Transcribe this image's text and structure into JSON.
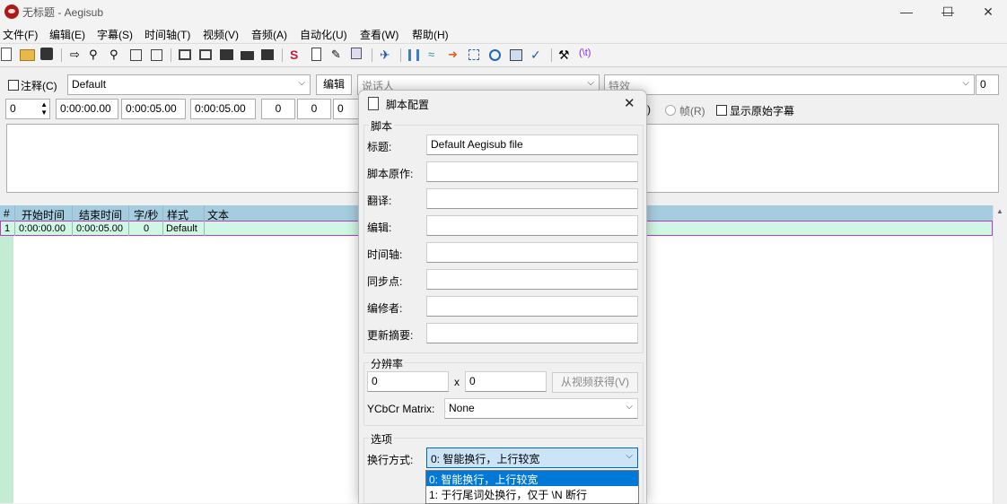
{
  "window": {
    "title": "无标题 - Aegisub",
    "minimize": "—",
    "maximize": "☐",
    "close": "✕"
  },
  "menu": [
    "文件(F)",
    "编辑(E)",
    "字幕(S)",
    "时间轴(T)",
    "视频(V)",
    "音频(A)",
    "自动化(U)",
    "查看(W)",
    "帮助(H)"
  ],
  "toolbar": {
    "icons": [
      "new-file-icon",
      "open-folder-icon",
      "save-icon",
      "jump-icon",
      "zoom-in-icon",
      "zoom-out-icon",
      "snapshot-icon",
      "snapshot-clip-icon",
      "video-icon",
      "video-frame-icon",
      "filmstrip-icon",
      "clapper-icon",
      "script-s-icon",
      "clipboard-icon",
      "pencil-icon",
      "copy-icon",
      "pin-icon",
      "split-icon",
      "timing-icon",
      "arrow-icon",
      "select-icon",
      "clock-icon",
      "resample-icon",
      "check-icon",
      "tools-icon",
      "lua-icon"
    ]
  },
  "edit": {
    "comment_label": "注释(C)",
    "style_value": "Default",
    "edit_button": "编辑",
    "actor_placeholder": "说话人",
    "effect_placeholder": "特效",
    "layer_value": "0",
    "layer_right_value": "0",
    "start_time": "0:00:00.00",
    "end_time": "0:00:05.00",
    "duration": "0:00:05.00",
    "margin_l": "0",
    "margin_r": "0",
    "margin_v": "0",
    "time_radio_suffix": ")",
    "frame_radio_label": "帧(R)",
    "show_original_label": "显示原始字幕"
  },
  "grid": {
    "headers": [
      "#",
      "开始时间",
      "结束时间",
      "字/秒",
      "样式",
      "文本"
    ],
    "rows": [
      {
        "num": "1",
        "start": "0:00:00.00",
        "end": "0:00:05.00",
        "cps": "0",
        "style": "Default",
        "text": ""
      }
    ]
  },
  "dialog": {
    "title": "脚本配置",
    "close": "✕",
    "script_group": "脚本",
    "fields": [
      {
        "label": "标题:",
        "value": "Default Aegisub file"
      },
      {
        "label": "脚本原作:",
        "value": ""
      },
      {
        "label": "翻译:",
        "value": ""
      },
      {
        "label": "编辑:",
        "value": ""
      },
      {
        "label": "时间轴:",
        "value": ""
      },
      {
        "label": "同步点:",
        "value": ""
      },
      {
        "label": "编修者:",
        "value": ""
      },
      {
        "label": "更新摘要:",
        "value": ""
      }
    ],
    "resolution_group": "分辨率",
    "res_x": "0",
    "res_separator": "x",
    "res_y": "0",
    "from_video_button": "从视频获得(V)",
    "ycbcr_label": "YCbCr Matrix:",
    "ycbcr_value": "None",
    "options_group": "选项",
    "wrap_label": "换行方式:",
    "wrap_value": "0: 智能换行，上行较宽",
    "wrap_options": [
      "0: 智能换行，上行较宽",
      "1: 于行尾词处换行，仅于 \\N 断行"
    ]
  }
}
